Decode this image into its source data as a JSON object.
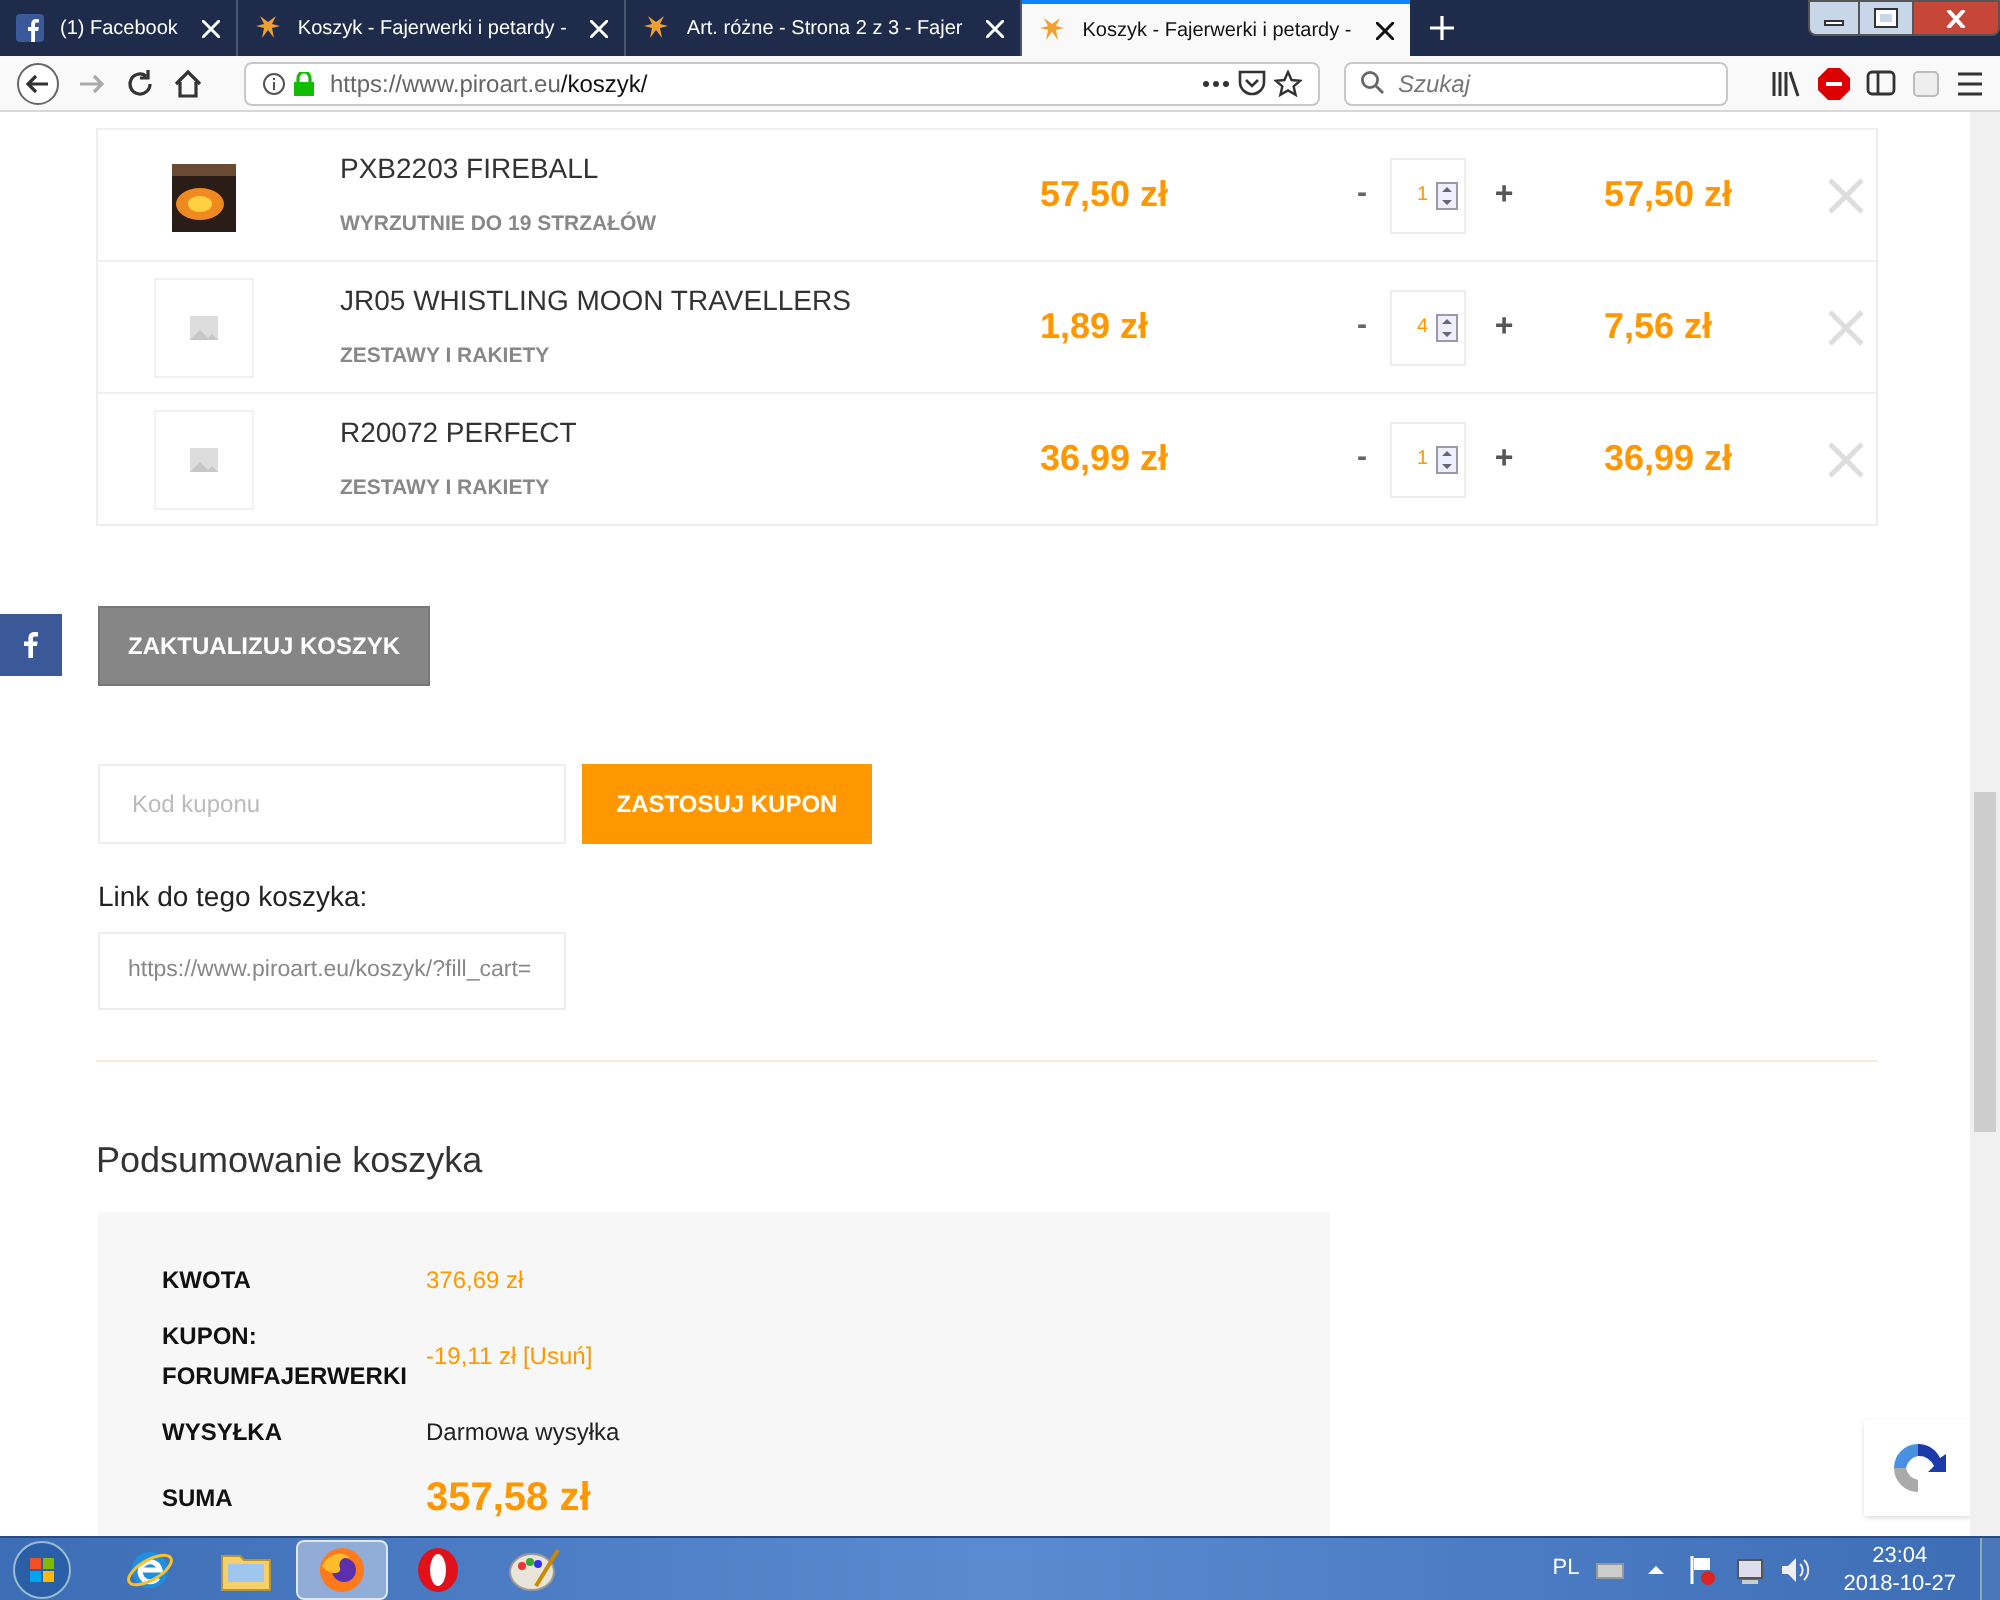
{
  "browser": {
    "tabs": [
      {
        "title": "(1) Facebook",
        "kind": "facebook",
        "selected": false
      },
      {
        "title": "Koszyk - Fajerwerki i petardy -",
        "kind": "site",
        "selected": false
      },
      {
        "title": "Art. różne - Strona 2 z 3 - Fajer",
        "kind": "site",
        "selected": false
      },
      {
        "title": "Koszyk - Fajerwerki i petardy -",
        "kind": "site",
        "selected": true
      }
    ],
    "url_host": "https://www.piroart.eu",
    "url_path": "/koszyk/",
    "search_placeholder": "Szukaj"
  },
  "cart_items": [
    {
      "name": "PXB2203 FIREBALL",
      "category": "WYRZUTNIE DO 19 STRZAŁÓW",
      "price": "57,50 zł",
      "minus": "-",
      "quantity": "1",
      "plus": "+",
      "subtotal": "57,50 zł",
      "kind": "photo"
    },
    {
      "name": "JR05 WHISTLING MOON TRAVELLERS",
      "category": "ZESTAWY I RAKIETY",
      "price": "1,89 zł",
      "minus": "-",
      "quantity": "4",
      "plus": "+",
      "subtotal": "7,56 zł",
      "kind": "placeholder"
    },
    {
      "name": "R20072 PERFECT",
      "category": "ZESTAWY I RAKIETY",
      "price": "36,99 zł",
      "minus": "-",
      "quantity": "1",
      "plus": "+",
      "subtotal": "36,99 zł",
      "kind": "placeholder"
    }
  ],
  "update_button": "ZAKTUALIZUJ KOSZYK",
  "coupon": {
    "placeholder": "Kod kuponu",
    "button": "ZASTOSUJ KUPON"
  },
  "cart_link": {
    "label": "Link do tego koszyka:",
    "value": "https://www.piroart.eu/koszyk/?fill_cart="
  },
  "summary": {
    "title": "Podsumowanie koszyka",
    "rows": [
      {
        "label": "KWOTA",
        "value": "376,69 zł",
        "kind": "price"
      },
      {
        "label": "KUPON: FORUMFAJERWERKI",
        "value": "-19,11 zł [Usuń]",
        "kind": "price"
      },
      {
        "label": "WYSYŁKA",
        "value": "Darmowa wysyłka",
        "kind": "plain"
      },
      {
        "label": "SUMA",
        "value": "357,58 zł",
        "kind": "total"
      }
    ]
  },
  "taskbar": {
    "apps": [
      {
        "kind": "ie",
        "selected": false
      },
      {
        "kind": "explorer",
        "selected": false
      },
      {
        "kind": "firefox",
        "selected": true
      },
      {
        "kind": "opera",
        "selected": false
      },
      {
        "kind": "paint",
        "selected": false
      }
    ],
    "language": "PL",
    "time": "23:04",
    "date": "2018-10-27"
  }
}
